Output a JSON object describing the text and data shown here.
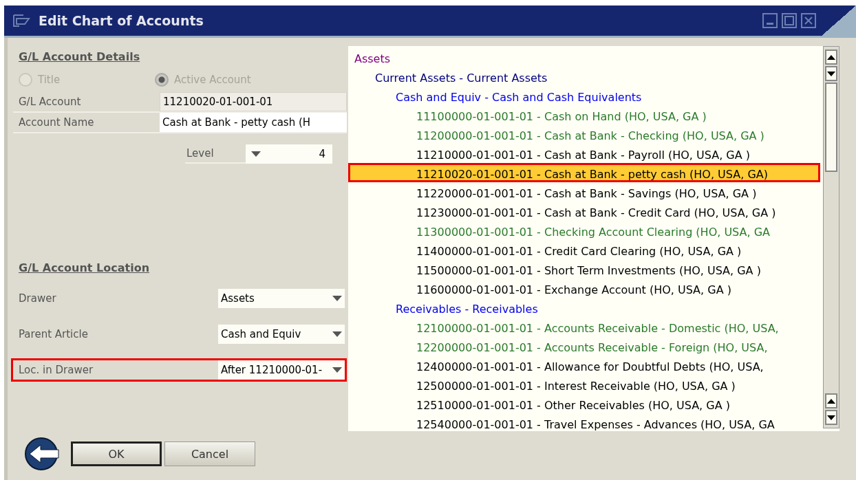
{
  "window": {
    "title": "Edit Chart of Accounts"
  },
  "details": {
    "heading": "G/L Account Details",
    "radios": [
      {
        "label": "Title",
        "checked": false,
        "disabled": true
      },
      {
        "label": "Active Account",
        "checked": true,
        "disabled": true
      }
    ],
    "fields": [
      {
        "label": "G/L Account",
        "value": "11210020-01-001-01",
        "editable": false
      },
      {
        "label": "Account Name",
        "value": "Cash at Bank - petty cash (H",
        "editable": true
      }
    ],
    "level": {
      "label": "Level",
      "value": "4"
    }
  },
  "location": {
    "heading": "G/L Account Location",
    "fields": [
      {
        "label": "Drawer",
        "value": "Assets",
        "highlighted": false
      },
      {
        "label": "Parent Article",
        "value": "Cash and Equiv",
        "highlighted": false
      },
      {
        "label": "Loc. in Drawer",
        "value": "After 11210000-01-",
        "highlighted": true
      }
    ]
  },
  "tree": [
    {
      "label": "Assets",
      "color": "#800080",
      "selected": false,
      "children": [
        {
          "label": "Current Assets - Current Assets",
          "color": "#000080",
          "selected": false,
          "children": [
            {
              "label": "Cash and Equiv - Cash and Cash Equivalents",
              "color": "#0000ee",
              "selected": false,
              "children": [
                {
                  "label": "11100000-01-001-01 - Cash on Hand (HO, USA, GA )",
                  "color": "#2a7a2a",
                  "selected": false
                },
                {
                  "label": "11200000-01-001-01 - Cash at Bank - Checking (HO, USA, GA )",
                  "color": "#2a7a2a",
                  "selected": false
                },
                {
                  "label": "11210000-01-001-01 - Cash at Bank - Payroll (HO, USA, GA )",
                  "color": "#000000",
                  "selected": false
                },
                {
                  "label": "11210020-01-001-01 - Cash at Bank - petty cash (HO, USA, GA)",
                  "color": "#000000",
                  "selected": true
                },
                {
                  "label": "11220000-01-001-01 - Cash at Bank - Savings (HO, USA, GA )",
                  "color": "#000000",
                  "selected": false
                },
                {
                  "label": "11230000-01-001-01 - Cash at Bank - Credit Card (HO, USA, GA )",
                  "color": "#000000",
                  "selected": false
                },
                {
                  "label": "11300000-01-001-01 - Checking Account Clearing (HO, USA, GA",
                  "color": "#2a7a2a",
                  "selected": false
                },
                {
                  "label": "11400000-01-001-01 - Credit Card Clearing (HO, USA, GA )",
                  "color": "#000000",
                  "selected": false
                },
                {
                  "label": "11500000-01-001-01 - Short Term Investments (HO, USA, GA )",
                  "color": "#000000",
                  "selected": false
                },
                {
                  "label": "11600000-01-001-01 - Exchange Account (HO, USA, GA )",
                  "color": "#000000",
                  "selected": false
                }
              ]
            },
            {
              "label": "Receivables - Receivables",
              "color": "#0000ee",
              "selected": false,
              "children": [
                {
                  "label": "12100000-01-001-01 - Accounts Receivable - Domestic (HO, USA,",
                  "color": "#2a7a2a",
                  "selected": false
                },
                {
                  "label": "12200000-01-001-01 - Accounts Receivable - Foreign (HO, USA,",
                  "color": "#2a7a2a",
                  "selected": false
                },
                {
                  "label": "12400000-01-001-01 - Allowance for Doubtful Debts (HO, USA,",
                  "color": "#000000",
                  "selected": false
                },
                {
                  "label": "12500000-01-001-01 - Interest Receivable (HO, USA, GA )",
                  "color": "#000000",
                  "selected": false
                },
                {
                  "label": "12510000-01-001-01 - Other Receivables (HO, USA, GA )",
                  "color": "#000000",
                  "selected": false
                },
                {
                  "label": "12540000-01-001-01 - Travel Expenses - Advances (HO, USA, GA",
                  "color": "#000000",
                  "selected": false
                }
              ]
            }
          ]
        }
      ]
    }
  ],
  "buttons": [
    {
      "label": "OK",
      "default": true
    },
    {
      "label": "Cancel",
      "default": false
    }
  ]
}
